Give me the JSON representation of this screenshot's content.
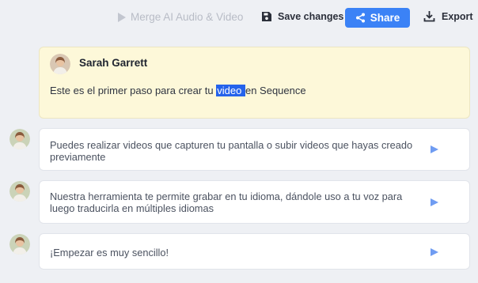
{
  "toolbar": {
    "merge_label": "Merge AI Audio & Video",
    "save_label": "Save changes",
    "share_label": "Share",
    "export_label": "Export"
  },
  "colors": {
    "accent": "#3b82f6",
    "highlight_card": "#fdf8d9",
    "selection": "#2563eb"
  },
  "main": {
    "speaker": "Sarah Garrett",
    "text_before": "Este es el primer paso para crear tu ",
    "text_selected": "video ",
    "text_after": "en Sequence"
  },
  "rows": [
    {
      "text": "Puedes realizar videos que capturen tu pantalla o subir videos que hayas creado previamente"
    },
    {
      "text": "Nuestra herramienta te permite grabar en tu idioma, dándole uso a tu voz para luego traducirla en múltiples idiomas"
    },
    {
      "text": "¡Empezar es muy sencillo!"
    }
  ]
}
